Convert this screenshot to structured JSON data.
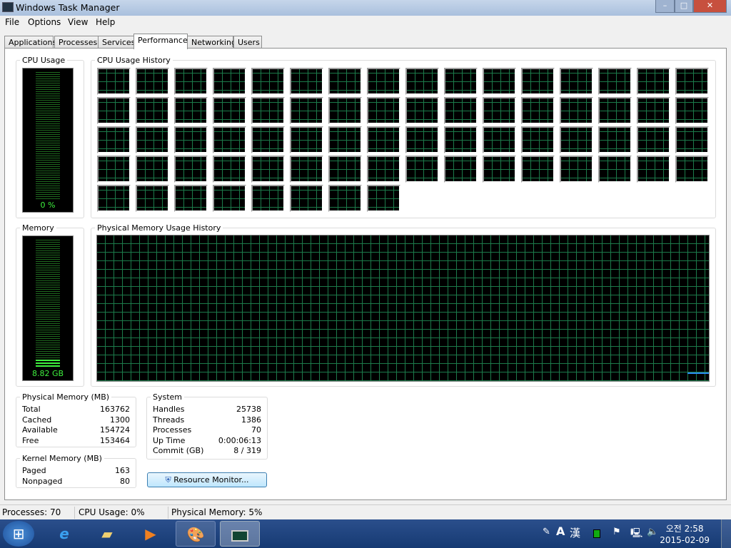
{
  "window": {
    "title": "Windows Task Manager",
    "controls": [
      "–",
      "□",
      "✕"
    ]
  },
  "menu": [
    "File",
    "Options",
    "View",
    "Help"
  ],
  "tabs": [
    {
      "label": "Applications"
    },
    {
      "label": "Processes"
    },
    {
      "label": "Services"
    },
    {
      "label": "Performance",
      "active": true
    },
    {
      "label": "Networking"
    },
    {
      "label": "Users"
    }
  ],
  "cpu_usage": {
    "label": "CPU Usage",
    "value": "0 %",
    "percent": 0
  },
  "cpu_history": {
    "label": "CPU Usage History",
    "core_count": 72
  },
  "memory": {
    "label": "Memory",
    "value": "8.82 GB",
    "percent": 5
  },
  "memory_history": {
    "label": "Physical Memory Usage History"
  },
  "physical_memory": {
    "label": "Physical Memory (MB)",
    "rows": [
      {
        "k": "Total",
        "v": "163762"
      },
      {
        "k": "Cached",
        "v": "1300"
      },
      {
        "k": "Available",
        "v": "154724"
      },
      {
        "k": "Free",
        "v": "153464"
      }
    ]
  },
  "kernel_memory": {
    "label": "Kernel Memory (MB)",
    "rows": [
      {
        "k": "Paged",
        "v": "163"
      },
      {
        "k": "Nonpaged",
        "v": "80"
      }
    ]
  },
  "system": {
    "label": "System",
    "rows": [
      {
        "k": "Handles",
        "v": "25738"
      },
      {
        "k": "Threads",
        "v": "1386"
      },
      {
        "k": "Processes",
        "v": "70"
      },
      {
        "k": "Up Time",
        "v": "0:00:06:13"
      },
      {
        "k": "Commit (GB)",
        "v": "8 / 319"
      }
    ]
  },
  "resource_monitor_label": "Resource Monitor...",
  "status": {
    "processes": "Processes: 70",
    "cpu": "CPU Usage: 0%",
    "memory": "Physical Memory: 5%"
  },
  "taskbar": {
    "ime_a": "A",
    "ime_han": "漢",
    "time": "오전 2:58",
    "date": "2015-02-09"
  },
  "colors": {
    "graph_green": "#3ef03e",
    "grid": "#1c7a4a",
    "accent": "#163a73"
  }
}
